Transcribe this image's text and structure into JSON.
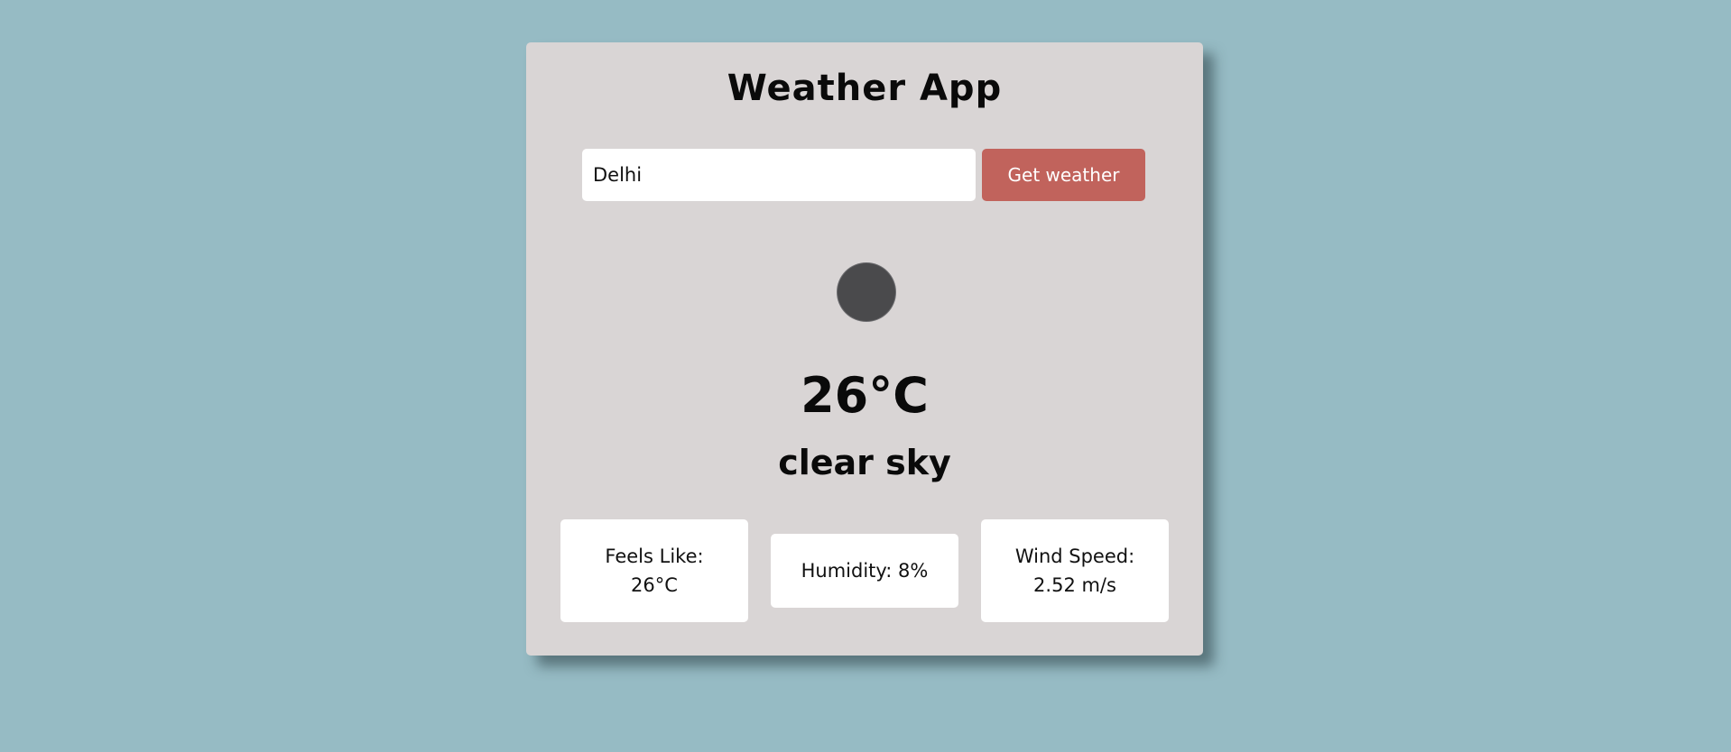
{
  "app": {
    "title": "Weather App"
  },
  "search": {
    "value": "Delhi",
    "button_label": "Get weather"
  },
  "weather": {
    "icon": "weather-condition-icon",
    "temperature": "26°C",
    "description": "clear sky"
  },
  "stats": {
    "feels_like_label": "Feels Like:",
    "feels_like_value": "26°C",
    "humidity_text": "Humidity: 8%",
    "wind_speed_label": "Wind Speed:",
    "wind_speed_value": "2.52 m/s"
  },
  "colors": {
    "page_background": "#96bbc4",
    "card_background": "#d9d5d5",
    "button_background": "#c1635c",
    "button_text": "#ffffff"
  }
}
